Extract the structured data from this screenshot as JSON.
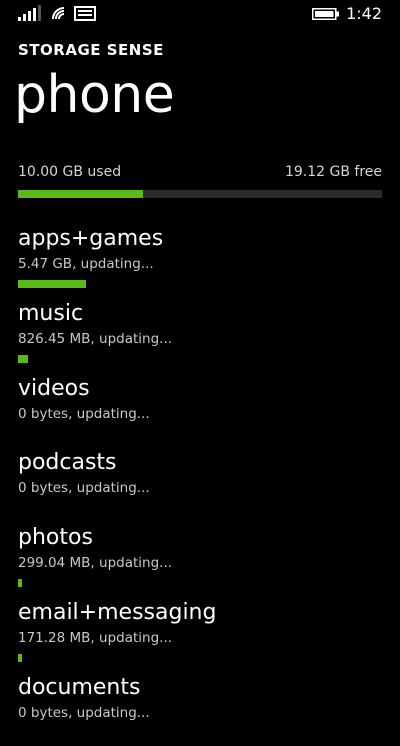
{
  "status_bar": {
    "time": "1:42",
    "icons": [
      "signal-icon",
      "wifi-icon",
      "message-icon",
      "battery-icon"
    ]
  },
  "header": {
    "app_title": "STORAGE SENSE",
    "page_title": "phone"
  },
  "usage": {
    "used_label": "10.00 GB used",
    "free_label": "19.12 GB free",
    "used_fraction": 0.343
  },
  "categories": [
    {
      "name": "apps+games",
      "size": "5.47 GB, updating...",
      "bar_fraction": 0.188
    },
    {
      "name": "music",
      "size": "826.45 MB, updating...",
      "bar_fraction": 0.028
    },
    {
      "name": "videos",
      "size": "0 bytes, updating...",
      "bar_fraction": 0
    },
    {
      "name": "podcasts",
      "size": "0 bytes, updating...",
      "bar_fraction": 0
    },
    {
      "name": "photos",
      "size": "299.04 MB, updating...",
      "bar_fraction": 0.01
    },
    {
      "name": "email+messaging",
      "size": "171.28 MB, updating...",
      "bar_fraction": 0.006
    },
    {
      "name": "documents",
      "size": "0 bytes, updating...",
      "bar_fraction": 0
    }
  ],
  "colors": {
    "accent": "#5cb916",
    "background": "#000000",
    "track": "#2a2a2a",
    "text": "#ffffff",
    "secondary_text": "#c8c8c8"
  }
}
